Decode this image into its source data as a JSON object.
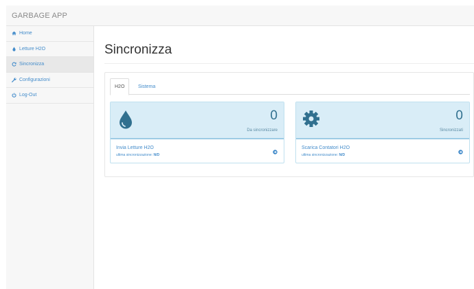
{
  "app": {
    "title": "GARBAGE APP"
  },
  "sidebar": {
    "items": [
      {
        "label": "Home",
        "icon": "home-icon"
      },
      {
        "label": "Letture H2O",
        "icon": "drop-icon"
      },
      {
        "label": "Sincronizza",
        "icon": "refresh-icon",
        "active": true
      },
      {
        "label": "Configurazioni",
        "icon": "wrench-icon"
      },
      {
        "label": "Log-Out",
        "icon": "power-icon"
      }
    ]
  },
  "main": {
    "title": "Sincronizza",
    "tabs": [
      {
        "label": "H2O",
        "active": true
      },
      {
        "label": "Sistema",
        "active": false
      }
    ],
    "cards": [
      {
        "icon": "water-drop-icon",
        "count": "0",
        "subtitle": "Da sincronizzare",
        "action": "Invia Letture H2O",
        "meta_label": "ultima sincronizzazione:",
        "meta_value": "N/D"
      },
      {
        "icon": "gear-icon",
        "count": "0",
        "subtitle": "Sincronizzati",
        "action": "Scarica Contatori H2O",
        "meta_label": "ultima sincronizzazione:",
        "meta_value": "N/D"
      }
    ]
  },
  "colors": {
    "link": "#428bca",
    "card_head": "#d9edf7",
    "card_text": "#31708f"
  }
}
